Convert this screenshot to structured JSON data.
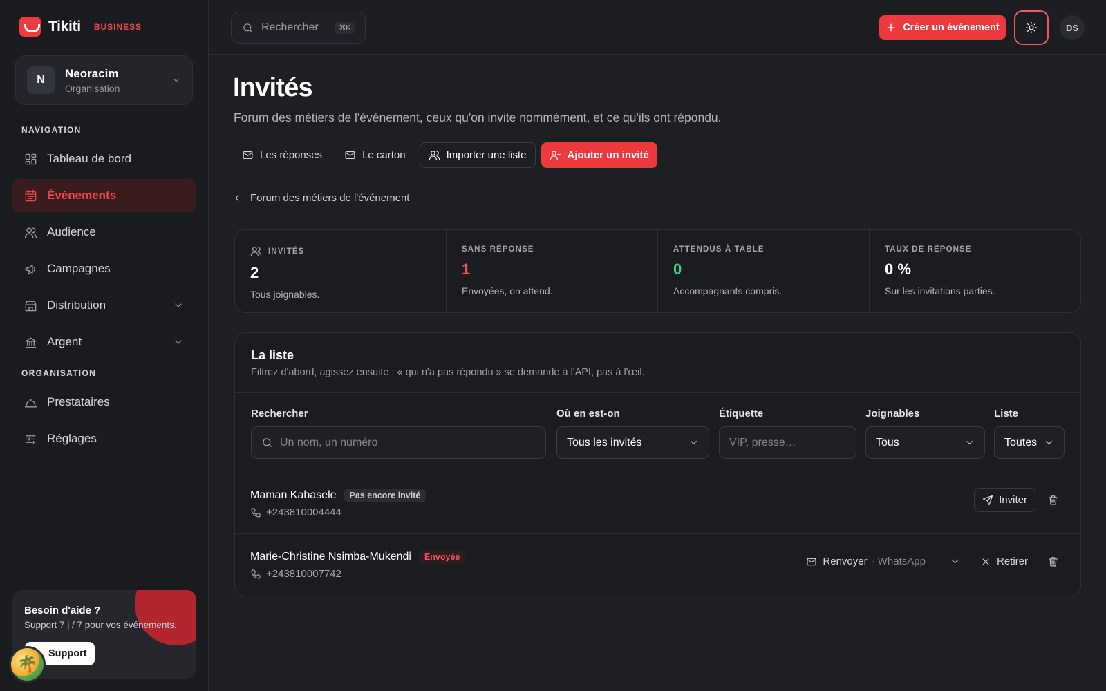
{
  "brand": {
    "name": "Tikiti",
    "badge": "BUSINESS"
  },
  "org": {
    "initial": "N",
    "name": "Neoracim",
    "role": "Organisation"
  },
  "nav": {
    "section_nav": "NAVIGATION",
    "section_org": "ORGANISATION",
    "items": [
      {
        "label": "Tableau de bord"
      },
      {
        "label": "Événements"
      },
      {
        "label": "Audience"
      },
      {
        "label": "Campagnes"
      },
      {
        "label": "Distribution"
      },
      {
        "label": "Argent"
      },
      {
        "label": "Prestataires"
      },
      {
        "label": "Réglages"
      }
    ]
  },
  "help": {
    "title": "Besoin d'aide ?",
    "subtitle": "Support 7 j / 7 pour vos événements.",
    "button": "Support"
  },
  "topbar": {
    "search_placeholder": "Rechercher",
    "search_shortcut": "⌘K",
    "create_label": "Créer un événement",
    "user_initials": "DS"
  },
  "page": {
    "title": "Invités",
    "subtitle": "Forum des métiers de l'événement, ceux qu'on invite nommément, et ce qu'ils ont répondu.",
    "actions": [
      "Les réponses",
      "Le carton",
      "Importer une liste",
      "Ajouter un invité"
    ],
    "back_label": "Forum des métiers de l'événement"
  },
  "stats": [
    {
      "label": "INVITÉS",
      "value": "2",
      "desc": "Tous joignables.",
      "color": "#ffffff"
    },
    {
      "label": "SANS RÉPONSE",
      "value": "1",
      "desc": "Envoyées, on attend.",
      "color": "#f0565a"
    },
    {
      "label": "ATTENDUS À TABLE",
      "value": "0",
      "desc": "Accompagnants compris.",
      "color": "#3ccf8e"
    },
    {
      "label": "TAUX DE RÉPONSE",
      "value": "0 %",
      "desc": "Sur les invitations parties.",
      "color": "#ffffff"
    }
  ],
  "list": {
    "title": "La liste",
    "subtitle": "Filtrez d'abord, agissez ensuite : « qui n'a pas répondu » se demande à l'API, pas à l'œil.",
    "filters": {
      "search_label": "Rechercher",
      "search_placeholder": "Un nom, un numéro",
      "status_label": "Où en est-on",
      "status_value": "Tous les invités",
      "tag_label": "Étiquette",
      "tag_placeholder": "VIP, presse…",
      "reach_label": "Joignables",
      "reach_value": "Tous",
      "list_label": "Liste",
      "list_value": "Toutes"
    },
    "rows": [
      {
        "name": "Maman Kabasele",
        "status": "Pas encore invité",
        "phone": "+243810004444",
        "action": "Inviter"
      },
      {
        "name": "Marie-Christine Nsimba-Mukendi",
        "status": "Envoyée",
        "phone": "+243810007742",
        "action": "Renvoyer",
        "channel": "· WhatsApp",
        "remove": "Retirer"
      }
    ]
  }
}
